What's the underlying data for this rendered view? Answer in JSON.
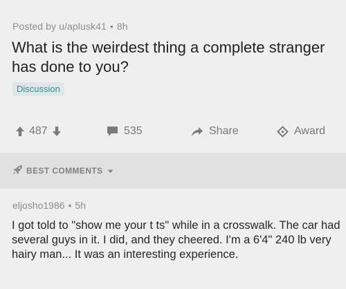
{
  "post": {
    "author_line": "Posted by u/aplusk41",
    "age": "8h",
    "title": "What is the weirdest thing a complete stranger has done to you?",
    "flair": "Discussion"
  },
  "actions": {
    "votes": "487",
    "comments": "535",
    "share_label": "Share",
    "award_label": "Award"
  },
  "sort": {
    "label": "BEST COMMENTS",
    "icon": "rocket-icon"
  },
  "comment": {
    "author": "eljosho1986",
    "age": "5h",
    "body": "I got told to \"show me your t ts\" while in a crosswalk. The car had several guys in it. I did, and they cheered. I'm a 6'4\" 240 lb very hairy man... It was an interesting experience."
  },
  "colors": {
    "background": "#efefef",
    "sortbar": "#e1e1e1",
    "flair_text": "#3e8a91",
    "flair_bg": "#dfe6e7",
    "muted_text": "#8d8d8d"
  }
}
